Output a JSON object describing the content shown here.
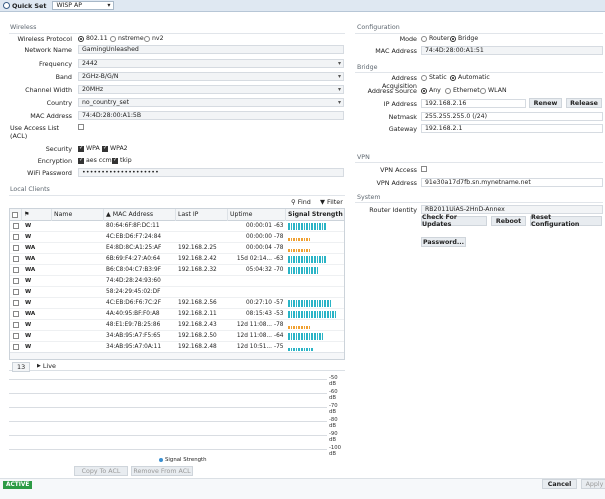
{
  "topbar": {
    "title": "Quick Set",
    "mode": "WISP AP"
  },
  "wireless": {
    "section": "Wireless",
    "protocol_label": "Wireless Protocol",
    "protocol_options": [
      "802.11",
      "nstreme",
      "nv2"
    ],
    "protocol_selected": "802.11",
    "network_name_label": "Network Name",
    "network_name": "GamingUnleashed",
    "frequency_label": "Frequency",
    "frequency": "2442",
    "band_label": "Band",
    "band": "2GHz-B/G/N",
    "channel_width_label": "Channel Width",
    "channel_width": "20MHz",
    "country_label": "Country",
    "country": "no_country_set",
    "mac_label": "MAC Address",
    "mac": "74:4D:28:00:A1:5B",
    "acl_label": "Use Access List (ACL)",
    "security_label": "Security",
    "security_wpa": "WPA",
    "security_wpa2": "WPA2",
    "encryption_label": "Encryption",
    "enc_aes": "aes ccm",
    "enc_tkip": "tkip",
    "wifi_password_label": "WiFi Password",
    "wifi_password": "••••••••••••••••••••"
  },
  "configuration": {
    "section": "Configuration",
    "mode_label": "Mode",
    "mode_router": "Router",
    "mode_bridge": "Bridge",
    "mac_label": "MAC Address",
    "mac": "74:4D:28:00:A1:51"
  },
  "bridge": {
    "section": "Bridge",
    "acq_label": "Address Acquisition",
    "acq_static": "Static",
    "acq_auto": "Automatic",
    "source_label": "Address Source",
    "src_any": "Any",
    "src_eth": "Ethernet",
    "src_wlan": "WLAN",
    "ip_label": "IP Address",
    "ip": "192.168.2.16",
    "netmask_label": "Netmask",
    "netmask": "255.255.255.0 (/24)",
    "gateway_label": "Gateway",
    "gateway": "192.168.2.1",
    "renew": "Renew",
    "release": "Release"
  },
  "vpn": {
    "section": "VPN",
    "access_label": "VPN Access",
    "address_label": "VPN Address",
    "address": "91e30a17d7fb.sn.mynetname.net"
  },
  "system": {
    "section": "System",
    "identity_label": "Router Identity",
    "identity": "RB2011UiAS-2HnD-Annex",
    "check_updates": "Check For Updates",
    "reboot": "Reboot",
    "reset": "Reset Configuration",
    "password": "Password..."
  },
  "clients": {
    "section": "Local Clients",
    "find": "Find",
    "filter": "Filter",
    "columns": [
      "Name",
      "MAC Address",
      "Last IP",
      "Uptime",
      "Signal Strength"
    ],
    "rows": [
      {
        "flag": "W",
        "mac": "80:64:6F:8F:DC:11",
        "ip": "",
        "uptime": "00:00:01",
        "signal": "-63",
        "color": "#2ab4c6"
      },
      {
        "flag": "W",
        "mac": "4C:EB:D6:F7:24:84",
        "ip": "",
        "uptime": "00:00:00",
        "signal": "-78",
        "color": "#f0a030"
      },
      {
        "flag": "WA",
        "mac": "E4:8D:8C:A1:25:AF",
        "ip": "192.168.2.25",
        "uptime": "00:00:04",
        "signal": "-78",
        "color": "#f0a030"
      },
      {
        "flag": "WA",
        "mac": "6B:69:F4:27:A0:64",
        "ip": "192.168.2.42",
        "uptime": "15d 02:14...",
        "signal": "-63",
        "color": "#2ab4c6"
      },
      {
        "flag": "WA",
        "mac": "B6:C8:04:C7:B3:9F",
        "ip": "192.168.2.32",
        "uptime": "05:04:32",
        "signal": "-70",
        "color": "#2ab4c6"
      },
      {
        "flag": "W",
        "mac": "74:4D:28:24:93:60",
        "ip": "",
        "uptime": "",
        "signal": "",
        "color": "#2ab4c6"
      },
      {
        "flag": "W",
        "mac": "58:24:29:45:02:DF",
        "ip": "",
        "uptime": "",
        "signal": "",
        "color": "#2ab4c6"
      },
      {
        "flag": "W",
        "mac": "4C:EB:D6:F6:7C:2F",
        "ip": "192.168.2.56",
        "uptime": "00:27:10",
        "signal": "-57",
        "color": "#2ab4c6"
      },
      {
        "flag": "WA",
        "mac": "4A:40:95:BF:F0:A8",
        "ip": "192.168.2.11",
        "uptime": "08:15:43",
        "signal": "-53",
        "color": "#2ab4c6"
      },
      {
        "flag": "W",
        "mac": "48:E1:E9:7B:25:86",
        "ip": "192.168.2.43",
        "uptime": "12d 11:08...",
        "signal": "-78",
        "color": "#f0a030"
      },
      {
        "flag": "W",
        "mac": "34:AB:95:A7:F5:65",
        "ip": "192.168.2.50",
        "uptime": "12d 11:08...",
        "signal": "-64",
        "color": "#2ab4c6"
      },
      {
        "flag": "W",
        "mac": "34:AB:95:A7:0A:11",
        "ip": "192.168.2.48",
        "uptime": "12d 10:51...",
        "signal": "-75",
        "color": "#2ab4c6"
      }
    ],
    "count": "13",
    "live_tab": "Live",
    "graph_labels": [
      "-50 dB",
      "-60 dB",
      "-70 dB",
      "-80 dB",
      "-90 dB",
      "-100 dB"
    ],
    "legend": "Signal Strength",
    "copy_to_acl": "Copy To ACL",
    "remove_from_acl": "Remove From ACL"
  },
  "footer": {
    "active": "ACTIVE",
    "cancel": "Cancel",
    "apply": "Apply"
  }
}
